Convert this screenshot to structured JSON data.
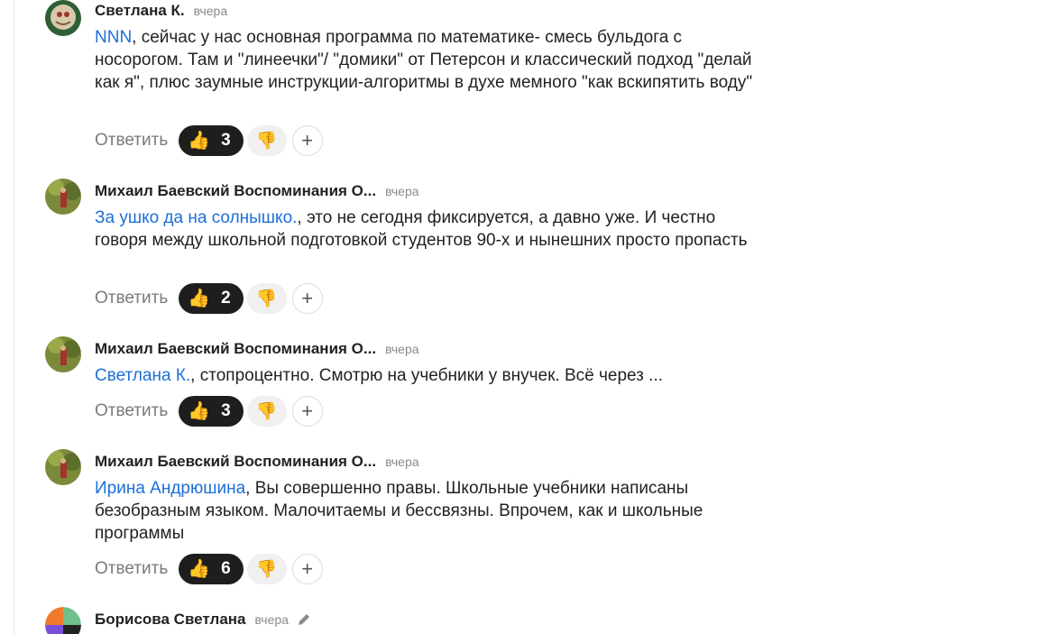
{
  "comments": [
    {
      "author": "Светлана К.",
      "time": "вчера",
      "mention": "NNN",
      "text": ", сейчас у нас основная программа по математике- смесь бульдога с носорогом. Там и \"линеечки\"/ \"домики\" от Петерсон и классический подход \"делай как я\", плюс заумные инструкции-алгоритмы в духе мемного \"как вскипятить воду\"",
      "reply_label": "Ответить",
      "likes": "3"
    },
    {
      "author": "Михаил Баевский Воспоминания О...",
      "time": "вчера",
      "mention": "За ушко да на солнышко.",
      "text": ", это не сегодня фиксируется, а давно уже. И честно говоря между школьной подготовкой студентов 90-х и нынешних просто пропасть",
      "reply_label": "Ответить",
      "likes": "2"
    },
    {
      "author": "Михаил Баевский Воспоминания О...",
      "time": "вчера",
      "mention": "Светлана К.",
      "text": ", стопроцентно. Смотрю на учебники у внучек. Всё через ...",
      "reply_label": "Ответить",
      "likes": "3"
    },
    {
      "author": "Михаил Баевский Воспоминания О...",
      "time": "вчера",
      "mention": "Ирина Андрюшина",
      "text": ", Вы совершенно правы. Школьные учебники написаны безобразным языком. Малочитаемы и бессвязны. Впрочем, как и школьные программы",
      "reply_label": "Ответить",
      "likes": "6"
    },
    {
      "author": "Борисова Светлана",
      "time": "вчера"
    }
  ],
  "icons": {
    "like": "thumbs-up-emoji",
    "dislike": "thumbs-down-emoji",
    "add": "plus-icon",
    "edit": "pencil-icon"
  },
  "colors": {
    "mention": "#1d6fd8",
    "like_pill": "#1e1e1e",
    "dislike_pill": "#f0f0f0"
  }
}
